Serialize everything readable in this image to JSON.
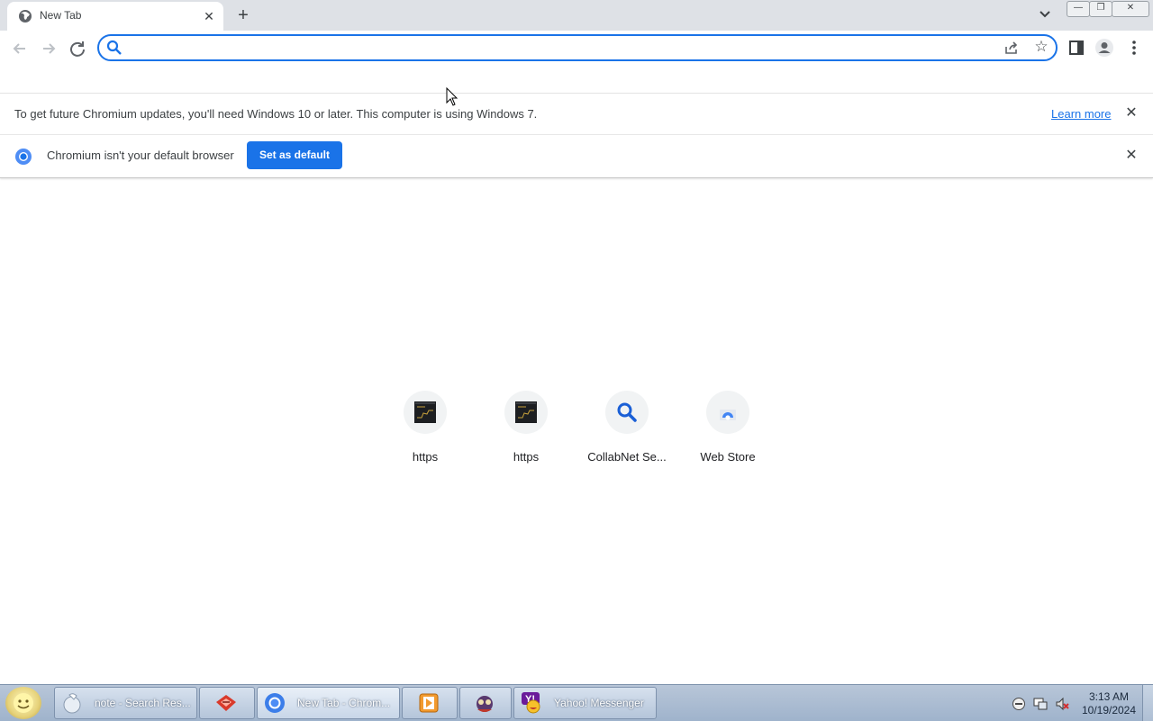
{
  "browser": {
    "tab": {
      "title": "New Tab",
      "close_label": "✕"
    },
    "new_tab_label": "+",
    "omnibox": {
      "value": "",
      "placeholder": ""
    }
  },
  "infobars": {
    "update": {
      "message": "To get future Chromium updates, you'll need Windows 10 or later. This computer is using Windows 7.",
      "learn_more": "Learn more",
      "close": "✕"
    },
    "default_browser": {
      "message": "Chromium isn't your default browser",
      "button": "Set as default",
      "close": "✕"
    }
  },
  "shortcuts": [
    {
      "label": "https",
      "icon": "terminal-thumbnail-icon"
    },
    {
      "label": "https",
      "icon": "terminal-thumbnail-icon"
    },
    {
      "label": "CollabNet Se...",
      "icon": "search-icon"
    },
    {
      "label": "Web Store",
      "icon": "web-store-icon"
    }
  ],
  "taskbar": {
    "items": [
      {
        "label": "note - Search Res...",
        "icon": "search-results-icon"
      },
      {
        "label": "",
        "icon": "red-app-icon"
      },
      {
        "label": "New Tab - Chrom...",
        "icon": "chromium-icon"
      },
      {
        "label": "",
        "icon": "media-player-icon"
      },
      {
        "label": "",
        "icon": "game-icon"
      },
      {
        "label": "Yahoo! Messenger",
        "icon": "yahoo-messenger-icon"
      }
    ],
    "clock": {
      "time": "3:13 AM",
      "date": "10/19/2024"
    }
  },
  "colors": {
    "accent": "#1a73e8",
    "tab_strip": "#dee1e6",
    "taskbar": "#a9bbd2"
  }
}
